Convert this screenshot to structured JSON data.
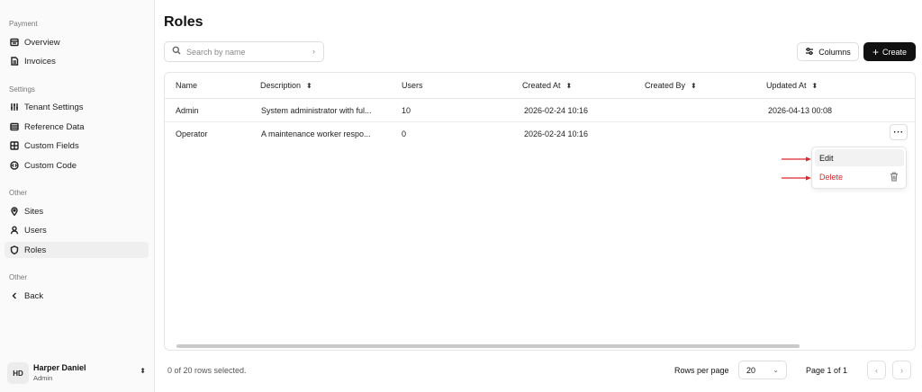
{
  "sidebar": {
    "sections": [
      {
        "label": "Payment"
      },
      {
        "label": "Settings"
      },
      {
        "label": "Other"
      },
      {
        "label": "Other"
      }
    ],
    "items": [
      {
        "label": "Overview",
        "icon": "overview-icon"
      },
      {
        "label": "Invoices",
        "icon": "invoice-icon"
      },
      {
        "label": "Tenant Settings",
        "icon": "sliders-icon"
      },
      {
        "label": "Reference Data",
        "icon": "database-icon"
      },
      {
        "label": "Custom Fields",
        "icon": "grid-icon"
      },
      {
        "label": "Custom Code",
        "icon": "code-icon"
      },
      {
        "label": "Sites",
        "icon": "map-pin-icon"
      },
      {
        "label": "Users",
        "icon": "user-icon"
      },
      {
        "label": "Roles",
        "icon": "shield-icon",
        "active": true
      },
      {
        "label": "Back",
        "icon": "chevron-left-icon"
      }
    ],
    "user": {
      "initials": "HD",
      "name": "Harper Daniel",
      "role": "Admin"
    }
  },
  "main": {
    "title": "Roles",
    "search": {
      "placeholder": "Search by name"
    },
    "columns_button": "Columns",
    "create_button": "Create",
    "table": {
      "headers": [
        "Name",
        "Description",
        "Users",
        "Created At",
        "Created By",
        "Updated At"
      ],
      "rows": [
        {
          "name": "Admin",
          "description": "System administrator with ful...",
          "users": "10",
          "created_at": "2026-02-24 10:16",
          "created_by": "",
          "updated_at": "2026-04-13 00:08"
        },
        {
          "name": "Operator",
          "description": "A maintenance worker respo...",
          "users": "0",
          "created_at": "2026-02-24 10:16",
          "created_by": "",
          "updated_at": ""
        }
      ],
      "row_actions_symbol": "···"
    },
    "menu": {
      "edit": "Edit",
      "delete": "Delete"
    },
    "footer": {
      "selected": "0 of 20 rows selected.",
      "rows_per_page_label": "Rows per page",
      "rows_per_page_value": "20",
      "page_info": "Page 1 of 1"
    }
  },
  "colors": {
    "accent": "#111111",
    "danger": "#d9282f",
    "annotation_arrow": "#d9282f"
  }
}
